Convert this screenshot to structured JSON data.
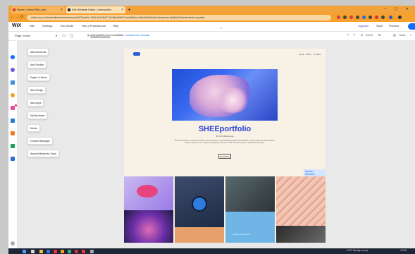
{
  "browser": {
    "tabs": [
      {
        "label": "Home | Home Site.com"
      },
      {
        "label": "Wix Website Editor | sheeportfo..."
      }
    ],
    "new_tab": "+",
    "window_controls": "– ▢ ✕",
    "url": "editor.wix.com/html/editor/web/renderer/edit/73a4e9c1-3f0d-4e2f-9b57-1d7a8ee5f5c2?metaSiteId=4b6c9d2a&editorSessionId=ab98cd7e&referralInfo=my-sites"
  },
  "wix_topbar": {
    "logo": "WiX",
    "menu": [
      "Site",
      "Settings",
      "Dev Mode",
      "Hire a Professional",
      "Help"
    ],
    "upgrade": "Upgrade",
    "save": "Save",
    "preview": "Preview"
  },
  "wix_secondbar": {
    "page": "Page: Home",
    "domain": "sheeportfolio.com",
    "domain_status": "is available.",
    "connect": "Connect Your Domain",
    "zoom": "100%",
    "tools": "Tools"
  },
  "panel_items": [
    {
      "label": "Add Elements"
    },
    {
      "label": "Add Section"
    },
    {
      "label": "Pages & Menu"
    },
    {
      "label": "Site Design"
    },
    {
      "label": "Add Apps"
    },
    {
      "label": "My Business"
    },
    {
      "label": "Media"
    },
    {
      "label": "Content Manager"
    },
    {
      "label": "Ascend Business Tools"
    }
  ],
  "site": {
    "nav": [
      "Home",
      "About",
      "Contact"
    ],
    "title": "SHEEportfolio",
    "subtitle": "By Shr Madonsela",
    "body": "This is the space to introduce visitors to the business or brand. Briefly explain who's behind it, what it does and what makes it unique. Share its core values and what this site has to offer. Use this space to showcase the brand.",
    "button": "Read More",
    "section_tag": "Section: Welcome",
    "gallery_caption": "Gallery Description"
  },
  "taskbar": {
    "weather": "13°C  Mostly sunny",
    "time": "10:56"
  },
  "colors": {
    "browser_chrome": "#f7a02e",
    "wix_blue": "#116dff",
    "title_blue": "#2a43d3",
    "page_bg": "#f7f1e6"
  }
}
